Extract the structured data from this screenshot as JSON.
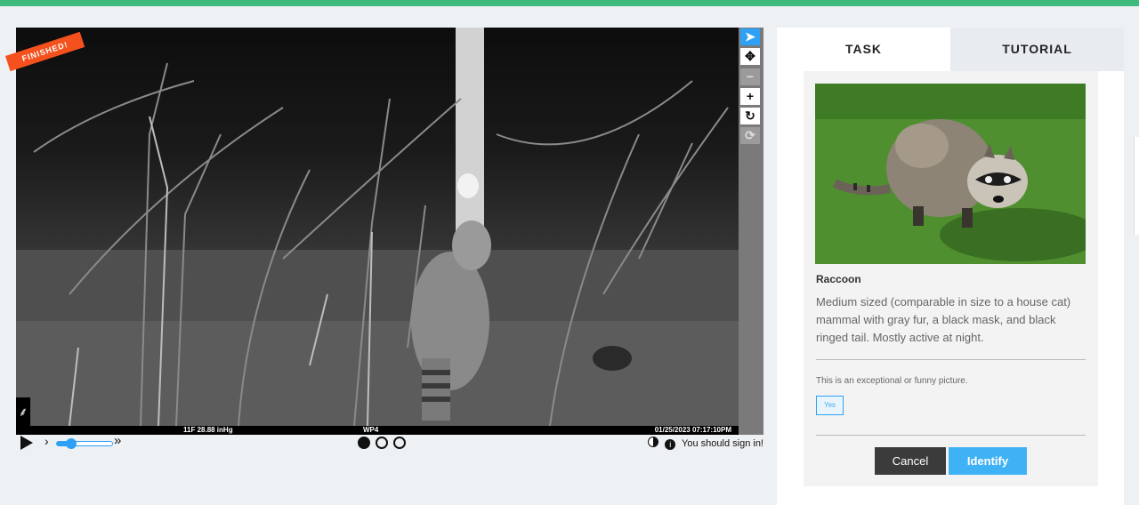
{
  "viewer": {
    "ribbon": "FINISHED!",
    "footer": {
      "temp": "11F  28.88 inHg",
      "camera": "WP4",
      "timestamp": "01/25/2023  07:17:10PM"
    },
    "tools": [
      {
        "name": "pointer-icon",
        "glyph": "➤"
      },
      {
        "name": "move-icon",
        "glyph": "✥"
      },
      {
        "name": "zoom-out-icon",
        "glyph": "−"
      },
      {
        "name": "zoom-in-icon",
        "glyph": "+"
      },
      {
        "name": "rotate-icon",
        "glyph": "↻"
      },
      {
        "name": "reset-icon",
        "glyph": "⟳"
      }
    ],
    "playback": {
      "slow_glyph": "›",
      "fast_glyph": "»",
      "speed_level": 0.25
    },
    "frames": {
      "count": 3,
      "current": 1
    },
    "signin_text": "You should sign in!",
    "info_glyph": "i"
  },
  "tabs": {
    "task": "TASK",
    "tutorial": "TUTORIAL"
  },
  "species": {
    "name": "Raccoon",
    "description": "Medium sized (comparable in size to a house cat) mammal with gray fur, a black mask, and black ringed tail. Mostly active at night."
  },
  "question": {
    "label": "This is an exceptional or funny picture.",
    "yes": "Yes"
  },
  "buttons": {
    "cancel": "Cancel",
    "identify": "Identify"
  },
  "colors": {
    "accent": "#2ea0f5",
    "identify": "#3fb2f5",
    "ribbon": "#f4511e",
    "topbar": "#3dbb7c"
  }
}
